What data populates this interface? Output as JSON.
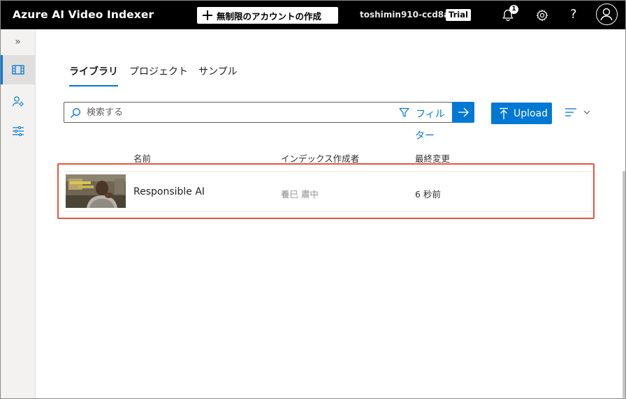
{
  "header": {
    "app_title": "Azure AI Video Indexer",
    "create_button_label": "無制限のアカウントの作成",
    "account_name": "toshimin910-ccd8ab",
    "plan_badge": "Trial",
    "notification_count": "1",
    "help_glyph": "?",
    "icons": [
      "bell-icon",
      "gear-icon",
      "help-icon",
      "user-avatar-icon"
    ]
  },
  "sidebar": {
    "expand_glyph": "»",
    "items": [
      {
        "icon": "film-icon",
        "active": true
      },
      {
        "icon": "person-settings-icon",
        "active": false
      },
      {
        "icon": "sliders-icon",
        "active": false
      }
    ]
  },
  "tabs": [
    {
      "label": "ライブラリ",
      "active": true
    },
    {
      "label": "プロジェクト",
      "active": false
    },
    {
      "label": "サンプル",
      "active": false
    }
  ],
  "search": {
    "placeholder": "検索する",
    "filter_label_line1": "フィル",
    "filter_label_line2": "ター"
  },
  "toolbar": {
    "upload_label": "Upload"
  },
  "table": {
    "columns": [
      "名前",
      "インデックス作成者",
      "最終変更"
    ],
    "rows": [
      {
        "name": "Responsible AI",
        "indexed_by": "養巳 肅中",
        "last_modified": "6 秒前"
      }
    ]
  },
  "colors": {
    "accent": "#0078d4",
    "topbar": "#000000",
    "highlight_border": "#e8553e"
  }
}
